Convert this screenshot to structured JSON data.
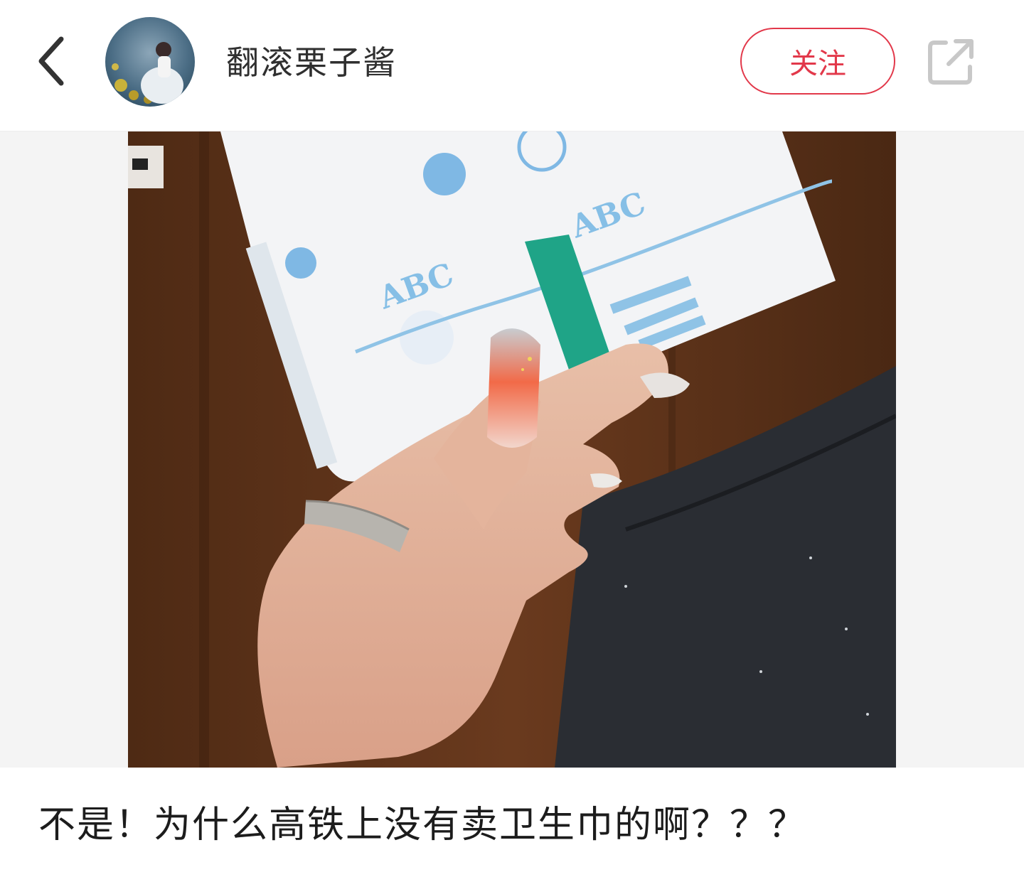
{
  "header": {
    "back_icon": "chevron-left-icon",
    "username": "翻滚栗子酱",
    "follow_label": "关注",
    "share_icon": "share-external-icon"
  },
  "post": {
    "image_pack_brand": "ABC",
    "caption": "不是！为什么高铁上没有卖卫生巾的啊？？？"
  },
  "colors": {
    "accent": "#e2384a",
    "icon_gray": "#c8c8c8",
    "text": "#2f2f2f"
  }
}
